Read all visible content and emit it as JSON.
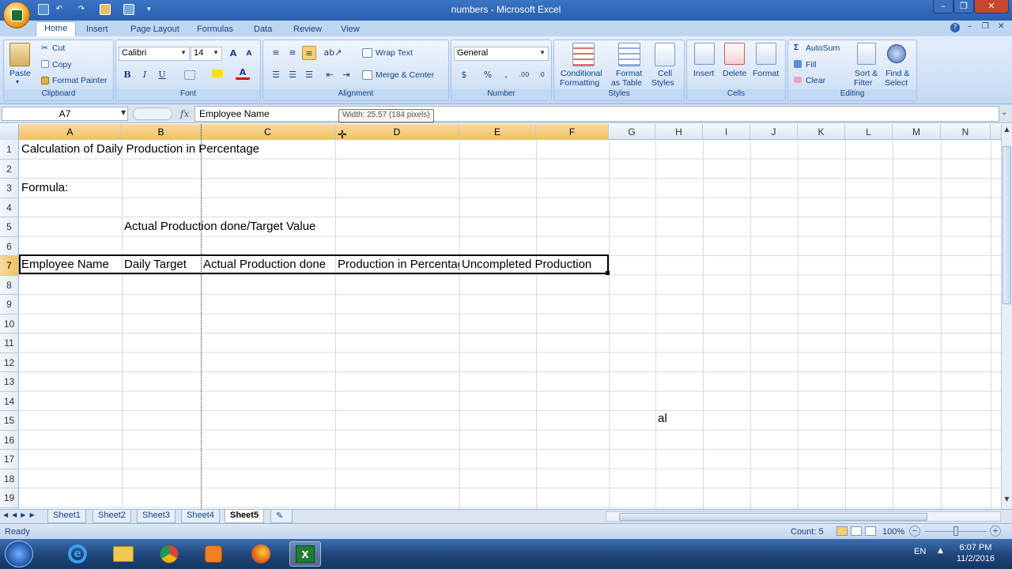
{
  "window": {
    "title": "numbers - Microsoft Excel"
  },
  "tabs": [
    "Home",
    "Insert",
    "Page Layout",
    "Formulas",
    "Data",
    "Review",
    "View"
  ],
  "ribbon": {
    "clipboard": {
      "paste": "Paste",
      "cut": "Cut",
      "copy": "Copy",
      "format_painter": "Format Painter",
      "label": "Clipboard"
    },
    "font": {
      "name": "Calibri",
      "size": "14",
      "label": "Font"
    },
    "alignment": {
      "wrap": "Wrap Text",
      "merge": "Merge & Center",
      "label": "Alignment"
    },
    "number": {
      "format": "General",
      "label": "Number"
    },
    "styles": {
      "conditional1": "Conditional",
      "conditional2": "Formatting",
      "format_table1": "Format",
      "format_table2": "as Table",
      "cell_styles1": "Cell",
      "cell_styles2": "Styles",
      "label": "Styles"
    },
    "cells": {
      "insert": "Insert",
      "delete": "Delete",
      "format": "Format",
      "label": "Cells"
    },
    "editing": {
      "autosum": "AutoSum",
      "fill": "Fill",
      "clear": "Clear",
      "sort1": "Sort &",
      "sort2": "Filter",
      "find1": "Find &",
      "find2": "Select",
      "label": "Editing"
    }
  },
  "formula_bar": {
    "name_box": "A7",
    "fx": "fx",
    "value": "Employee Name",
    "tooltip": "Width: 25.57 (184 pixels)"
  },
  "columns": [
    "A",
    "B",
    "C",
    "D",
    "E",
    "F",
    "G",
    "H",
    "I",
    "J",
    "K",
    "L",
    "M",
    "N"
  ],
  "rows": [
    "1",
    "2",
    "3",
    "4",
    "5",
    "6",
    "7",
    "8",
    "9",
    "10",
    "11",
    "12",
    "13",
    "14",
    "15",
    "16",
    "17",
    "18",
    "19"
  ],
  "cells": {
    "A1": "Calculation of Daily Production in Percentage",
    "A3": "Formula:",
    "B5": "Actual Production done/Target Value",
    "A7": "Employee Name",
    "B7": "Daily Target",
    "C7": "Actual Production done",
    "D7": "Production in Percentage",
    "E7": "Uncompleted Production",
    "H15": "al"
  },
  "sheets": [
    "Sheet1",
    "Sheet2",
    "Sheet3",
    "Sheet4",
    "Sheet5"
  ],
  "active_sheet": "Sheet5",
  "status": {
    "mode": "Ready",
    "count": "Count: 5",
    "zoom": "100%"
  },
  "taskbar": {
    "lang": "EN",
    "time": "6:07 PM",
    "date": "11/2/2016"
  },
  "colors": {
    "accent": "#15428b",
    "ribbon": "#cfe0f5",
    "selection_header": "#f1c15f"
  }
}
